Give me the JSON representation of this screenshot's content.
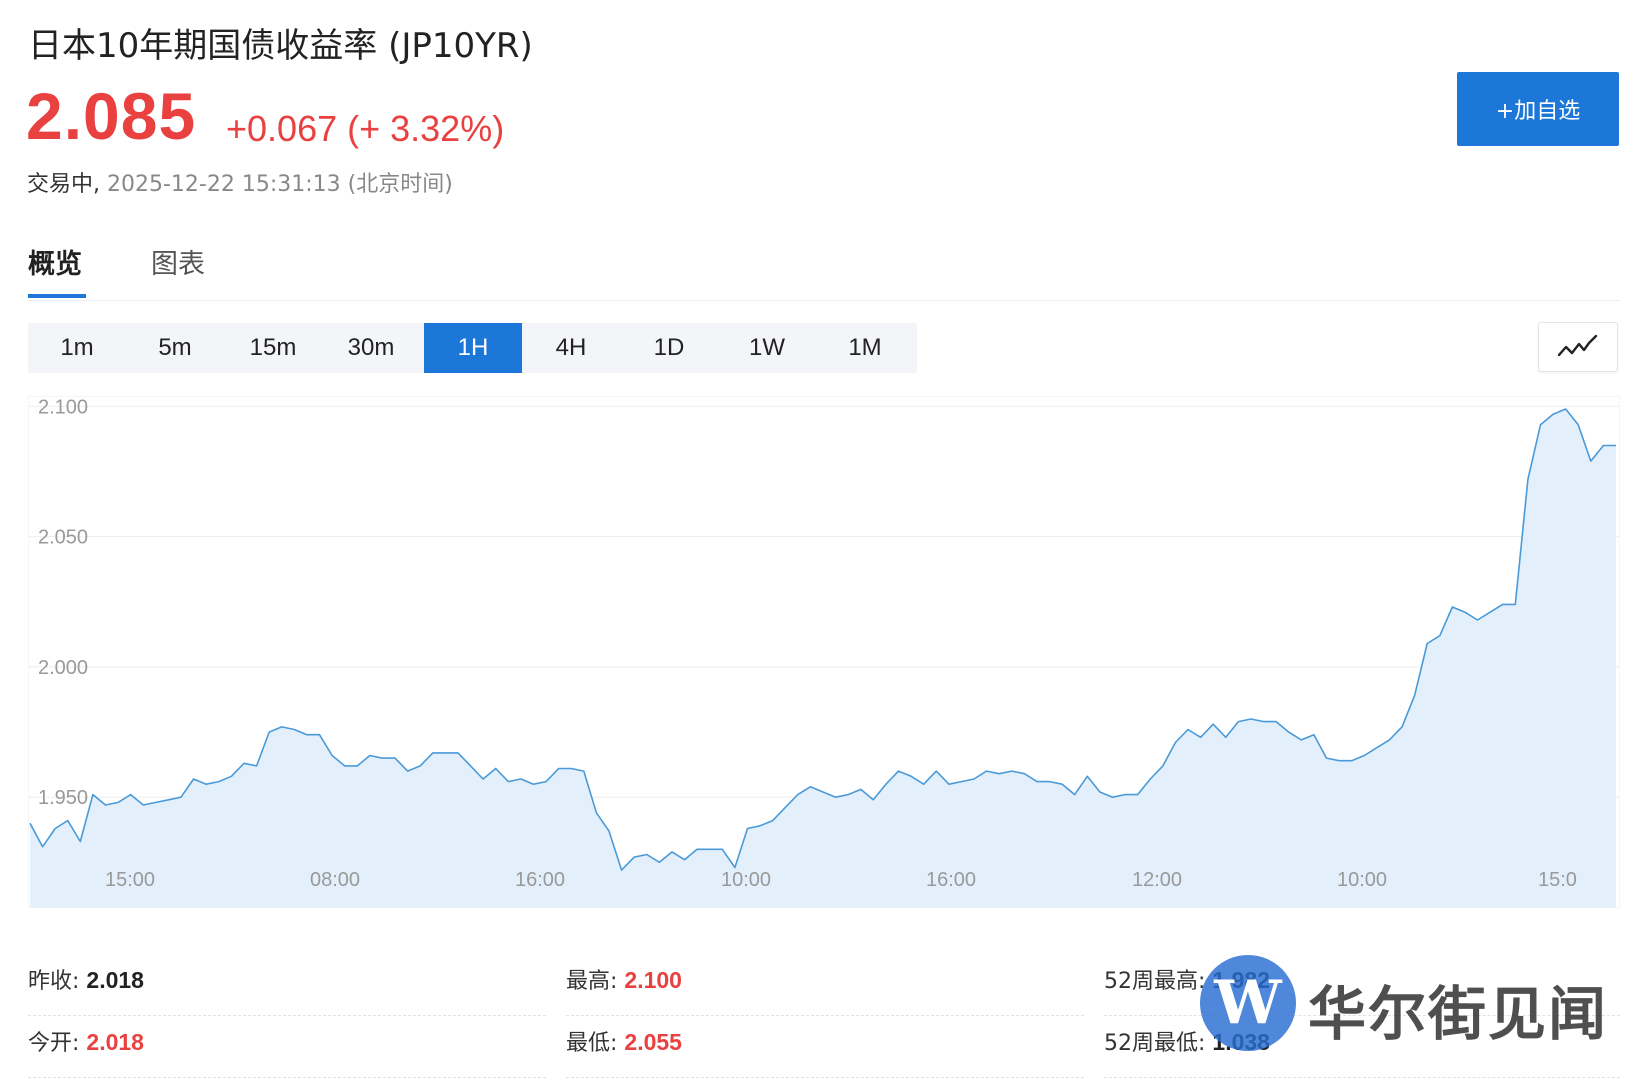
{
  "header": {
    "title": "日本10年期国债收益率 (JP10YR)",
    "price": "2.085",
    "change": "+0.067 (+ 3.32%)",
    "status_label": "交易中,",
    "status_time": "2025-12-22 15:31:13 (北京时间)",
    "add_watchlist_label": "+加自选"
  },
  "tabs": [
    {
      "label": "概览",
      "active": true
    },
    {
      "label": "图表",
      "active": false
    }
  ],
  "timeframes": [
    {
      "label": "1m",
      "active": false
    },
    {
      "label": "5m",
      "active": false
    },
    {
      "label": "15m",
      "active": false
    },
    {
      "label": "30m",
      "active": false
    },
    {
      "label": "1H",
      "active": true
    },
    {
      "label": "4H",
      "active": false
    },
    {
      "label": "1D",
      "active": false
    },
    {
      "label": "1W",
      "active": false
    },
    {
      "label": "1M",
      "active": false
    }
  ],
  "chart_type_icon": "line-chart-icon",
  "colors": {
    "accent": "#1d77d8",
    "up": "#e94040",
    "line": "#4a9ad8",
    "area": "#e3f0fc"
  },
  "chart_data": {
    "type": "area",
    "yticks": [
      "2.100",
      "2.050",
      "2.000",
      "1.950"
    ],
    "ylim": [
      1.909,
      2.104
    ],
    "xlabels": [
      "15:00",
      "08:00",
      "16:00",
      "10:00",
      "16:00",
      "12:00",
      "10:00",
      "15:0"
    ],
    "xlabel": "",
    "ylabel": "",
    "grid": true,
    "series": [
      {
        "values": [
          1.94,
          1.931,
          1.938,
          1.941,
          1.933,
          1.951,
          1.947,
          1.948,
          1.951,
          1.947,
          1.948,
          1.949,
          1.95,
          1.957,
          1.955,
          1.956,
          1.958,
          1.963,
          1.962,
          1.975,
          1.977,
          1.976,
          1.974,
          1.974,
          1.966,
          1.962,
          1.962,
          1.966,
          1.965,
          1.965,
          1.96,
          1.962,
          1.967,
          1.967,
          1.967,
          1.962,
          1.957,
          1.961,
          1.956,
          1.957,
          1.955,
          1.956,
          1.961,
          1.961,
          1.96,
          1.944,
          1.937,
          1.922,
          1.927,
          1.928,
          1.925,
          1.929,
          1.926,
          1.93,
          1.93,
          1.93,
          1.923,
          1.938,
          1.939,
          1.941,
          1.946,
          1.951,
          1.954,
          1.952,
          1.95,
          1.951,
          1.953,
          1.949,
          1.955,
          1.96,
          1.958,
          1.955,
          1.96,
          1.955,
          1.956,
          1.957,
          1.96,
          1.959,
          1.96,
          1.959,
          1.956,
          1.956,
          1.955,
          1.951,
          1.958,
          1.952,
          1.95,
          1.951,
          1.951,
          1.957,
          1.962,
          1.971,
          1.976,
          1.973,
          1.978,
          1.973,
          1.979,
          1.98,
          1.979,
          1.979,
          1.975,
          1.972,
          1.974,
          1.965,
          1.964,
          1.964,
          1.966,
          1.969,
          1.972,
          1.977,
          1.989,
          2.009,
          2.012,
          2.023,
          2.021,
          2.018,
          2.021,
          2.024,
          2.024,
          2.072,
          2.093,
          2.097,
          2.099,
          2.093,
          2.079,
          2.085,
          2.085
        ]
      }
    ]
  },
  "stats": {
    "prev_close_label": "昨收:",
    "prev_close_value": "2.018",
    "open_label": "今开:",
    "open_value": "2.018",
    "high_label": "最高:",
    "high_value": "2.100",
    "low_label": "最低:",
    "low_value": "2.055",
    "wk52_high_label": "52周最高:",
    "wk52_high_value": "1.982",
    "wk52_low_label": "52周最低:",
    "wk52_low_value": "1.038"
  },
  "watermark": {
    "logo": "W",
    "text": "华尔街见闻"
  }
}
